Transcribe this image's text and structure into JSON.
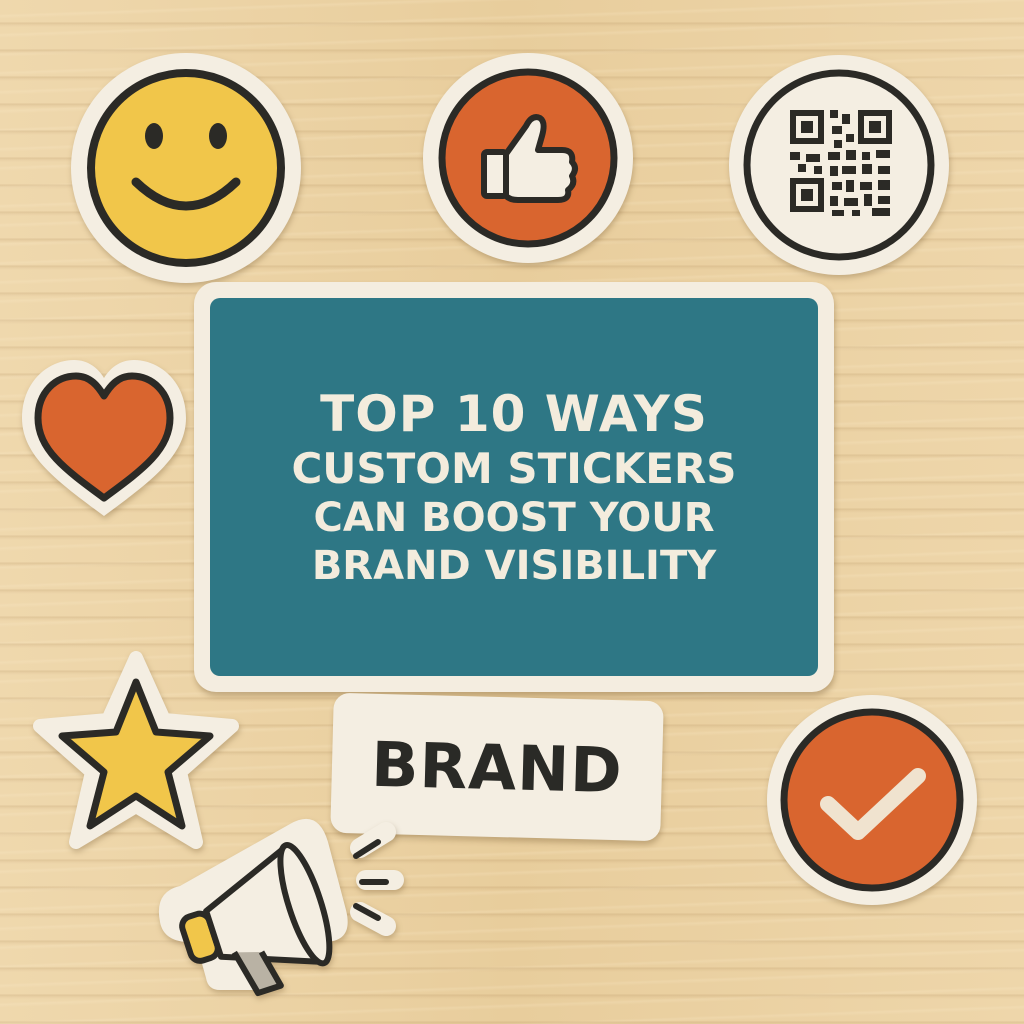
{
  "title_card": {
    "line1": "TOP 10 WAYS",
    "line2": "CUSTOM STICKERS",
    "line3": "CAN BOOST YOUR",
    "line4": "BRAND VISIBILITY"
  },
  "brand_sticker": {
    "text": "BRAND"
  },
  "stickers": [
    "smiley-face-icon",
    "thumbs-up-icon",
    "qr-code-icon",
    "heart-icon",
    "star-icon",
    "megaphone-icon",
    "checkmark-icon"
  ],
  "colors": {
    "panel_teal": "#2e7785",
    "sticker_orange": "#d9652f",
    "sticker_yellow": "#f1c64a",
    "outline_dark": "#2b2a26",
    "sticker_border": "#f4eee2",
    "wood": "#ecd3a6"
  }
}
